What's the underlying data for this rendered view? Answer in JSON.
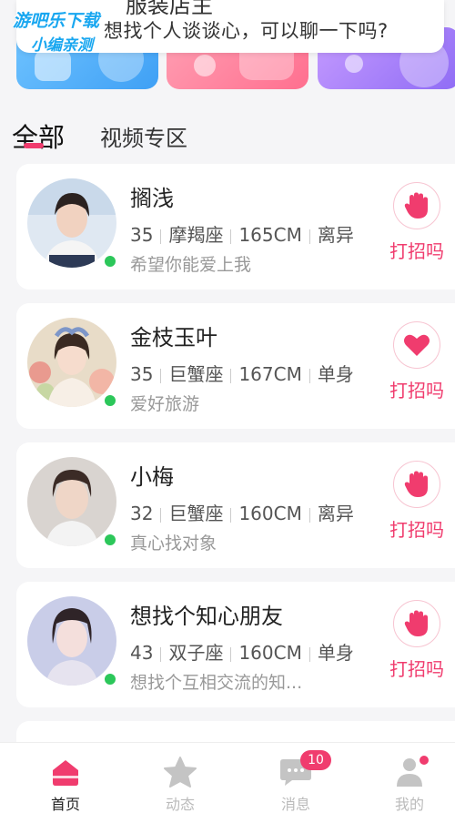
{
  "colors": {
    "accent": "#f03c6e",
    "online": "#2cc75a",
    "background": "#f5f5f7"
  },
  "watermark": {
    "line1": "游吧乐下载",
    "line2": "小编亲测"
  },
  "tooltip": {
    "line1": "服装店主",
    "line2": "想找个人谈谈心，可以聊一下吗?"
  },
  "tabs": [
    {
      "label": "全部",
      "active": true
    },
    {
      "label": "视频专区",
      "active": false
    }
  ],
  "greet_label": "打招吗",
  "users": [
    {
      "name": "搁浅",
      "age": "35",
      "zodiac": "摩羯座",
      "height": "165CM",
      "status": "离异",
      "motto": "希望你能爱上我",
      "greet_icon": "wave-hand-icon"
    },
    {
      "name": "金枝玉叶",
      "age": "35",
      "zodiac": "巨蟹座",
      "height": "167CM",
      "status": "单身",
      "motto": "爱好旅游",
      "greet_icon": "heart-icon"
    },
    {
      "name": "小梅",
      "age": "32",
      "zodiac": "巨蟹座",
      "height": "160CM",
      "status": "离异",
      "motto": "真心找对象",
      "greet_icon": "wave-hand-icon"
    },
    {
      "name": "想找个知心朋友",
      "age": "43",
      "zodiac": "双子座",
      "height": "160CM",
      "status": "单身",
      "motto": "想找个互相交流的知...",
      "greet_icon": "wave-hand-icon"
    }
  ],
  "nav": [
    {
      "label": "首页",
      "icon": "home-icon",
      "active": true
    },
    {
      "label": "动态",
      "icon": "star-icon",
      "active": false
    },
    {
      "label": "消息",
      "icon": "message-icon",
      "active": false,
      "badge": "10"
    },
    {
      "label": "我的",
      "icon": "profile-icon",
      "active": false,
      "dot": true
    }
  ]
}
